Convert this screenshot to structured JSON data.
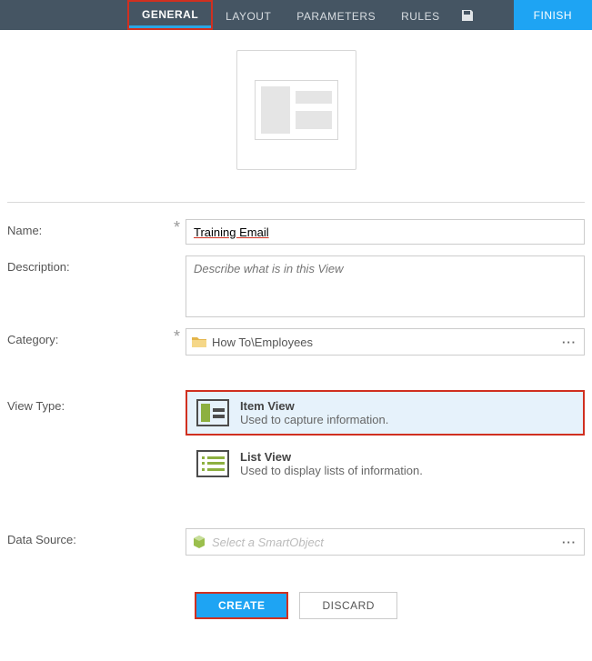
{
  "topbar": {
    "tabs": [
      {
        "label": "GENERAL",
        "active": true,
        "highlighted": true
      },
      {
        "label": "LAYOUT"
      },
      {
        "label": "PARAMETERS"
      },
      {
        "label": "RULES"
      }
    ],
    "finish": "FINISH"
  },
  "form": {
    "name_label": "Name:",
    "name_value": "Training Email",
    "description_label": "Description:",
    "description_placeholder": "Describe what is in this View",
    "category_label": "Category:",
    "category_value": "How To\\Employees",
    "viewtype_label": "View Type:",
    "item_view_title": "Item View",
    "item_view_desc": "Used to capture information.",
    "list_view_title": "List View",
    "list_view_desc": "Used to display lists of information.",
    "datasource_label": "Data Source:",
    "datasource_placeholder": "Select a SmartObject"
  },
  "actions": {
    "create": "CREATE",
    "discard": "DISCARD"
  },
  "colors": {
    "accent": "#1ea4f3",
    "highlight_border": "#d03020",
    "topbar": "#455563"
  }
}
